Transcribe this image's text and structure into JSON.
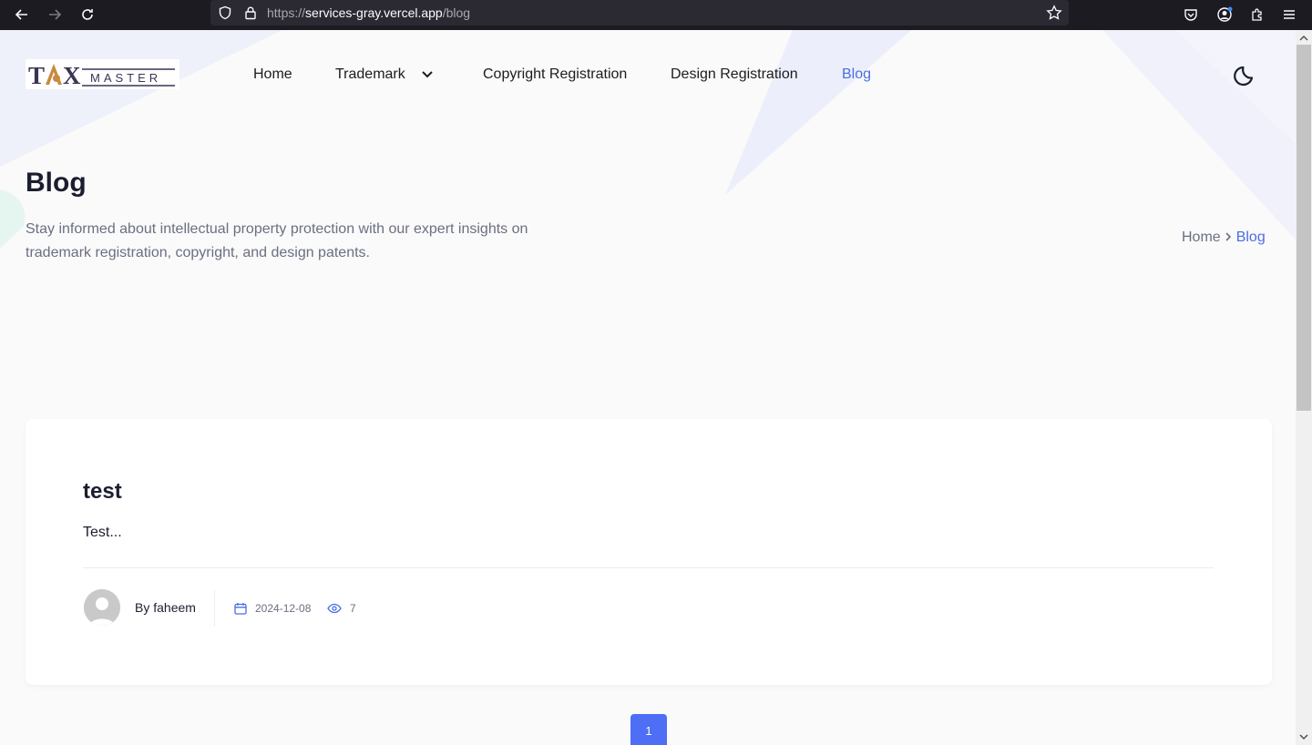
{
  "browser": {
    "url_scheme": "https://",
    "url_host": "services-gray.vercel.app",
    "url_path": "/blog"
  },
  "header": {
    "logo_text": "TAX MASTER",
    "nav": [
      {
        "label": "Home"
      },
      {
        "label": "Trademark"
      },
      {
        "label": "Copyright Registration"
      },
      {
        "label": "Design Registration"
      },
      {
        "label": "Blog",
        "active": true
      }
    ]
  },
  "hero": {
    "title": "Blog",
    "description": "Stay informed about intellectual property protection with our expert insights on trademark registration, copyright, and design patents.",
    "breadcrumb": {
      "home": "Home",
      "current": "Blog"
    }
  },
  "posts": [
    {
      "title": "test",
      "excerpt": "Test...",
      "author": "By faheem",
      "date": "2024-12-08",
      "views": "7"
    }
  ],
  "pagination": {
    "current_page": "1"
  },
  "colors": {
    "accent": "#4a6ee0",
    "page_button": "#4d6ef5",
    "heading": "#1b1e2e",
    "muted": "#6b6f80"
  }
}
